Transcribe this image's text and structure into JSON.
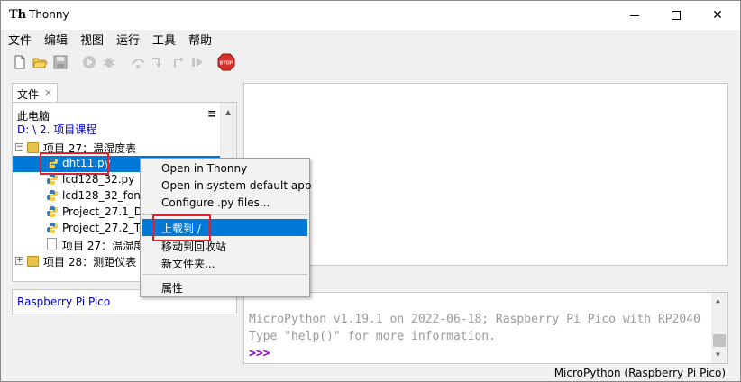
{
  "window": {
    "title": "Thonny",
    "app_icon_glyph": "Th",
    "minimize_glyph": "",
    "close_glyph": "✕"
  },
  "menubar": {
    "items": [
      "文件",
      "编辑",
      "视图",
      "运行",
      "工具",
      "帮助"
    ]
  },
  "toolbar": {
    "buttons": [
      "new-file-icon",
      "open-file-icon",
      "save-icon",
      "run-icon",
      "debug-icon",
      "step-over-icon",
      "step-into-icon",
      "step-out-icon",
      "resume-icon",
      "stop-icon"
    ],
    "stop_label": "STOP"
  },
  "files_panel": {
    "tab_label": "文件",
    "tab_close": "×",
    "location_title": "此电脑",
    "location_path": "D: \\ 2. 项目课程",
    "menu_glyph": "≡",
    "tree": [
      {
        "label": "项目 27：温湿度表",
        "type": "folder",
        "expander": "−"
      },
      {
        "label": "dht11.py",
        "type": "python",
        "selected": true
      },
      {
        "label": "lcd128_32.py",
        "type": "python"
      },
      {
        "label": "lcd128_32_fonts.",
        "type": "python"
      },
      {
        "label": "Project_27.1_Det",
        "type": "python"
      },
      {
        "label": "Project_27.2_Ter",
        "type": "python"
      },
      {
        "label": "项目 27：温湿度",
        "type": "file"
      },
      {
        "label": "项目 28：测距仪表",
        "type": "folder",
        "expander": "+"
      }
    ],
    "device_label": "Raspberry Pi Pico"
  },
  "context_menu": {
    "items": [
      {
        "label": "Open in Thonny"
      },
      {
        "label": "Open in system default app"
      },
      {
        "label": "Configure .py files..."
      },
      {
        "label": "上载到 /",
        "highlighted": true
      },
      {
        "label": "移动到回收站"
      },
      {
        "label": "新文件夹..."
      },
      {
        "label": "属性"
      }
    ]
  },
  "shell": {
    "lines": [
      "MicroPython v1.19.1 on 2022-06-18; Raspberry Pi Pico with RP2040",
      "Type \"help()\" for more information."
    ],
    "prompt": ">>>"
  },
  "statusbar": {
    "interpreter": "MicroPython (Raspberry Pi Pico)"
  },
  "colors": {
    "selection": "#0078d7",
    "highlight_box": "#e5202a",
    "path_blue": "#0000c8",
    "prompt_purple": "#8c00c8"
  }
}
